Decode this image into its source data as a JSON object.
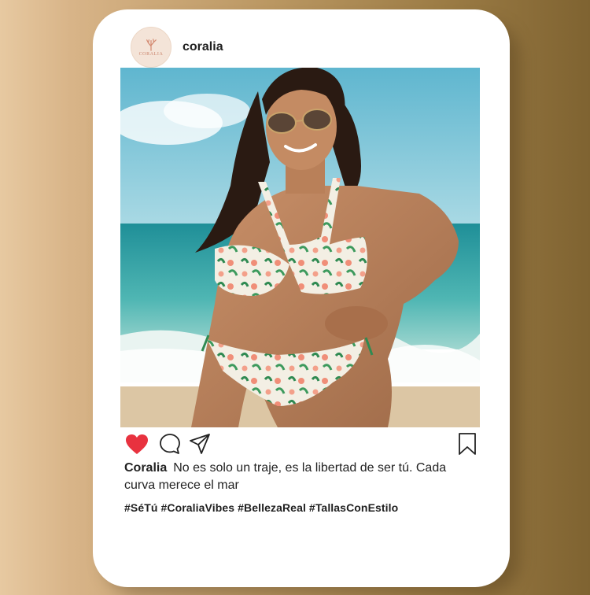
{
  "post": {
    "username": "coralia",
    "avatar": {
      "brand_text": "CORALIA",
      "icon": "coral-icon"
    },
    "image": {
      "icon": "photo-beach"
    },
    "actions": {
      "like_icon": "heart-icon",
      "comment_icon": "comment-icon",
      "share_icon": "paper-plane-icon",
      "save_icon": "bookmark-icon",
      "liked": true
    },
    "caption": {
      "author": "Coralia",
      "text": "No es solo un traje, es la libertad de ser tú. Cada curva merece el mar"
    },
    "hashtags": "#SéTú #CoraliaVibes #BellezaReal #TallasConEstilo"
  },
  "colors": {
    "like_red": "#e8323f",
    "brand_coral": "#c9826a",
    "card": "#ffffff"
  }
}
